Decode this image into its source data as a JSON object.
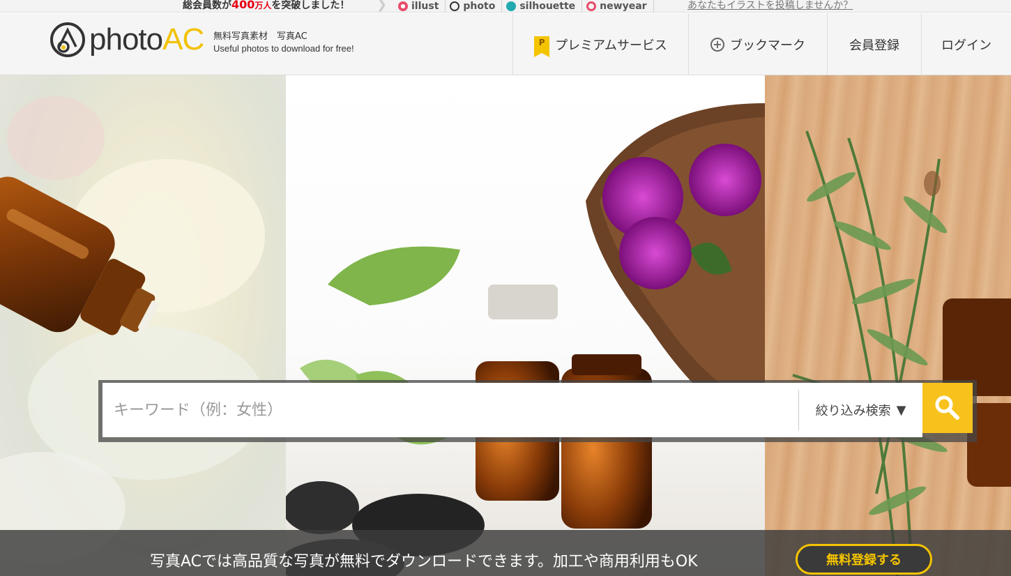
{
  "topbar": {
    "members_prefix": "総会員数が",
    "members_number": "400",
    "members_unit": "万人",
    "members_suffix": "を突破しました！",
    "sites": [
      {
        "label": "illust",
        "icon": "illust-icon",
        "color": "#e94b6b"
      },
      {
        "label": "photo",
        "icon": "photo-icon",
        "color": "#333333"
      },
      {
        "label": "silhouette",
        "icon": "silhouette-icon",
        "color": "#22aab0"
      },
      {
        "label": "newyear",
        "icon": "newyear-icon",
        "color": "#e94b6b"
      }
    ],
    "post_link": "あなたもイラストを投稿しませんか？"
  },
  "header": {
    "logo_photo": "photo",
    "logo_ac": "AC",
    "tagline_ja": "無料写真素材　写真AC",
    "tagline_en": "Useful photos to download for free!"
  },
  "nav": {
    "premium": "プレミアムサービス",
    "premium_icon_letter": "P",
    "bookmark": "ブックマーク",
    "register": "会員登録",
    "login": "ログイン"
  },
  "search": {
    "placeholder": "キーワード（例：女性）",
    "filter_label": "絞り込み検索",
    "filter_arrow": "▼"
  },
  "banner": {
    "text": "写真ACでは高品質な写真が無料でダウンロードできます。加工や商用利用もOK",
    "button": "無料登録する"
  },
  "colors": {
    "accent": "#f7c21b",
    "brand_yellow": "#f2c200",
    "alert_red": "#e60012"
  }
}
